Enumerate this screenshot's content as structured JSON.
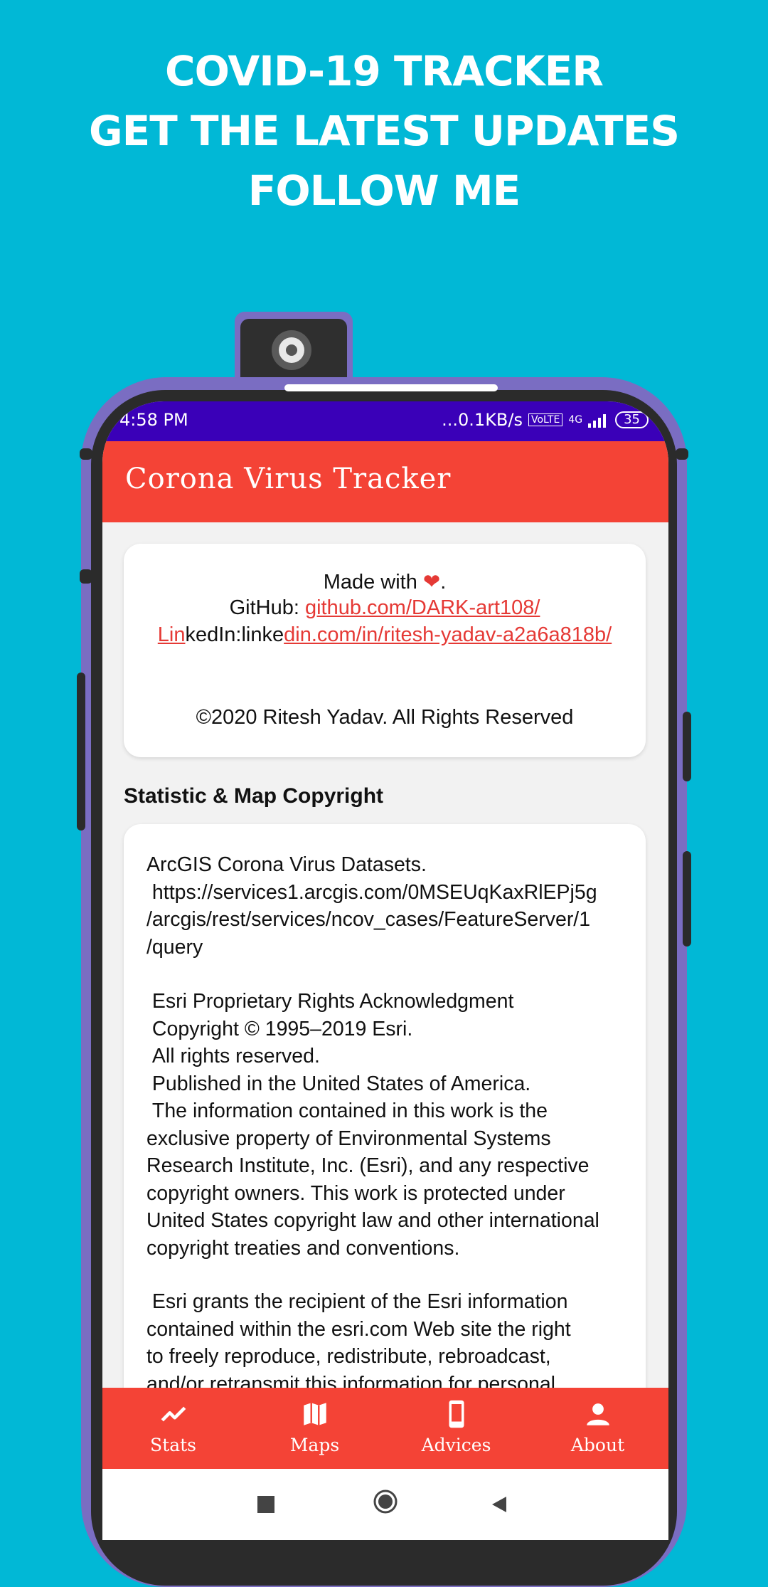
{
  "headline": {
    "line1": "COVID-19 TRACKER",
    "line2": "GET THE LATEST UPDATES",
    "line3": "FOLLOW ME"
  },
  "status_bar": {
    "time": "4:58 PM",
    "network": "...0.1KB/s",
    "signal_text": "4G",
    "battery": "35"
  },
  "app_bar": {
    "title": "Corona Virus Tracker"
  },
  "about_card": {
    "made_with": "Made with",
    "made_with_end": ".",
    "github_label": "GitHub: ",
    "github_link": "github.com/DARK-art108/",
    "linkedin_prefix_link": " Lin",
    "linkedin_label": "kedIn:linke",
    "linkedin_link": "din.com/in/ritesh-yadav-a2a6a818b/",
    "copyright": "©2020 Ritesh Yadav. All Rights Reserved"
  },
  "stat_section": {
    "title": "Statistic & Map Copyright",
    "para1": "ArcGIS Corona Virus Datasets.\n https://services1.arcgis.com/0MSEUqKaxRlEPj5g\n/arcgis/rest/services/ncov_cases/FeatureServer/1\n/query",
    "para2": " Esri Proprietary Rights Acknowledgment\n Copyright © 1995–2019 Esri.\n All rights reserved.\n Published in the United States of America.\n The information contained in this work is the\nexclusive property of Environmental Systems\nResearch Institute, Inc. (Esri), and any respective\ncopyright owners. This work is protected under\nUnited States copyright law and other international\ncopyright treaties and conventions.",
    "para3": " Esri grants the recipient of the Esri information\ncontained within the esri.com Web site the right\nto freely reproduce, redistribute, rebroadcast,\nand/or retransmit this information for personal"
  },
  "bottom_nav": {
    "items": [
      {
        "label": "Stats",
        "icon": "trending-up-icon"
      },
      {
        "label": "Maps",
        "icon": "map-icon"
      },
      {
        "label": "Advices",
        "icon": "phone-icon"
      },
      {
        "label": "About",
        "icon": "person-icon"
      }
    ]
  },
  "colors": {
    "background": "#01B8D6",
    "phone_frame": "#7A6DC2",
    "status_bar": "#3A00B8",
    "accent": "#F44336",
    "link": "#E53935"
  }
}
